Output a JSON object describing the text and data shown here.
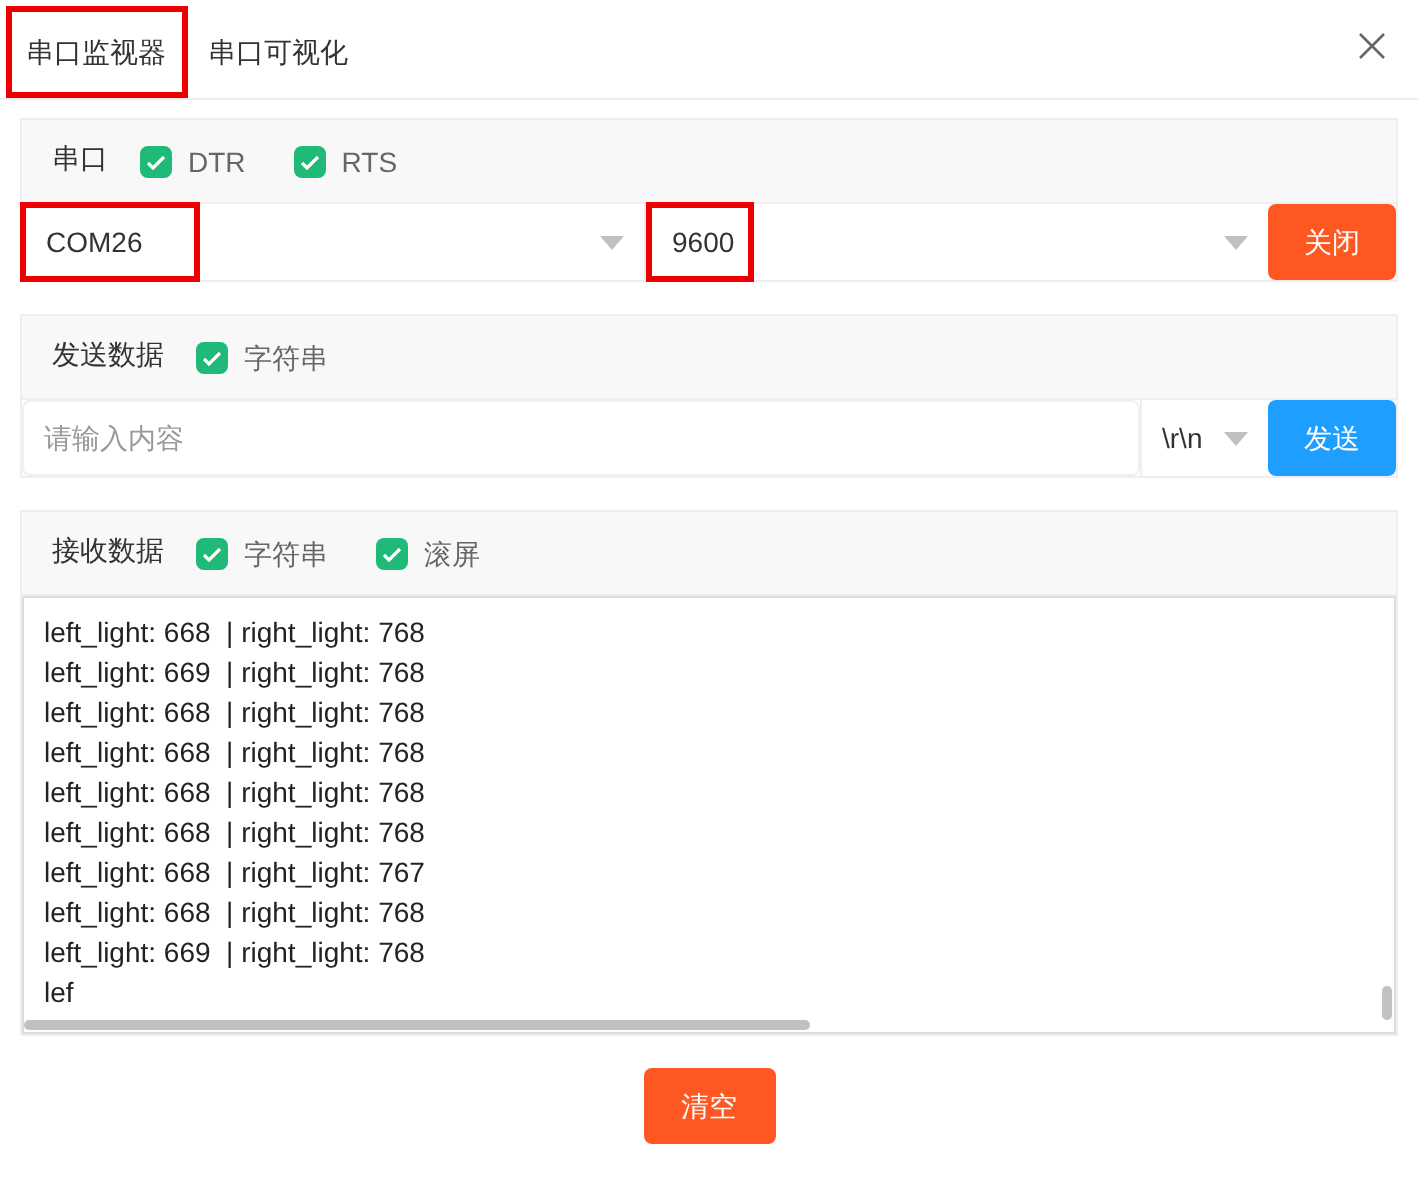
{
  "tabs": [
    {
      "label": "串口监视器",
      "selected": true,
      "highlighted": true
    },
    {
      "label": "串口可视化",
      "selected": false,
      "highlighted": false
    }
  ],
  "serial": {
    "title": "串口",
    "options": [
      {
        "label": "DTR",
        "checked": true
      },
      {
        "label": "RTS",
        "checked": true
      }
    ],
    "port": {
      "value": "COM26",
      "highlighted": true
    },
    "baud": {
      "value": "9600",
      "highlighted": true
    },
    "button": "关闭"
  },
  "send": {
    "title": "发送数据",
    "options": [
      {
        "label": "字符串",
        "checked": true
      }
    ],
    "placeholder": "请输入内容",
    "ending": "\\r\\n",
    "button": "发送"
  },
  "receive": {
    "title": "接收数据",
    "options": [
      {
        "label": "字符串",
        "checked": true
      },
      {
        "label": "滚屏",
        "checked": true
      }
    ],
    "lines": [
      "left_light: 668  | right_light: 768",
      "left_light: 669  | right_light: 768",
      "left_light: 668  | right_light: 768",
      "left_light: 668  | right_light: 768",
      "left_light: 668  | right_light: 768",
      "left_light: 668  | right_light: 768",
      "left_light: 668  | right_light: 767",
      "left_light: 668  | right_light: 768",
      "left_light: 669  | right_light: 768",
      "lef"
    ]
  },
  "clear_button": "清空"
}
